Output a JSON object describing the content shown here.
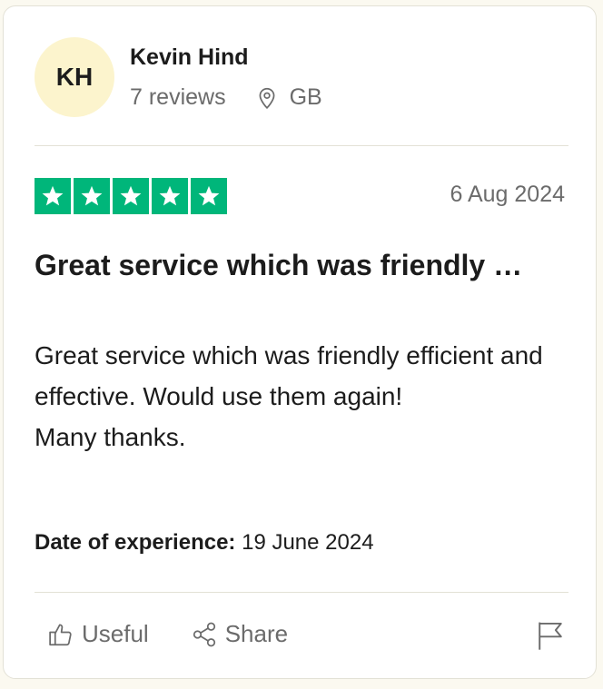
{
  "reviewer": {
    "initials": "KH",
    "name": "Kevin Hind",
    "review_count": "7 reviews",
    "country": "GB",
    "avatar_color": "#fcf4cd"
  },
  "review": {
    "rating": 5,
    "max_rating": 5,
    "star_color": "#00b67a",
    "date": "6 Aug 2024",
    "title": "Great service which was friendly …",
    "body": "Great service which was friendly efficient and effective. Would use them again!\nMany thanks.",
    "experience_label": "Date of experience:",
    "experience_date": "19 June 2024"
  },
  "actions": {
    "useful_label": "Useful",
    "share_label": "Share",
    "useful_icon": "thumbs-up-icon",
    "share_icon": "share-icon",
    "report_icon": "flag-icon"
  }
}
